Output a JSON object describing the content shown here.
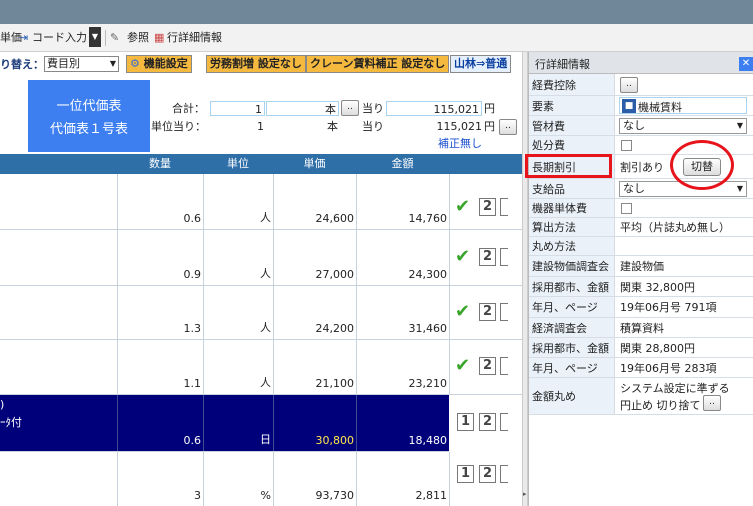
{
  "toolbar": {
    "cut_label": "単価",
    "code_input_label": "コード入力",
    "reference_label": "参照",
    "row_detail_label": "行詳細情報"
  },
  "options": {
    "switch_label": "り替え：",
    "category_select": "費目別",
    "function_settings": "機能設定",
    "labor_markup": "労務割増 設定なし",
    "crane_rent": "クレーン賃料補正 設定なし",
    "mountain_forest": "山林⇒普通"
  },
  "summary": {
    "blue_box_line1": "一位代価表",
    "blue_box_line2": "代価表１号表",
    "total_label": "合計：",
    "total_qty": "1",
    "total_unit": "本",
    "per_label": "当り",
    "total_amount": "115,021",
    "yen": "円",
    "per_unit_label": "単位当り：",
    "per_unit_qty": "1",
    "per_unit_unit": "本",
    "per_unit_per": "当り",
    "per_unit_amount": "115,021",
    "per_unit_yen": "円",
    "correction_link": "補正無し"
  },
  "table": {
    "headers": {
      "qty": "数量",
      "unit": "単位",
      "price": "単価",
      "amount": "金額"
    },
    "rows": [
      {
        "qty": "0.6",
        "unit": "人",
        "price": "24,600",
        "amount": "14,760",
        "check": "✔",
        "n1": "2"
      },
      {
        "qty": "0.9",
        "unit": "人",
        "price": "27,000",
        "amount": "24,300",
        "check": "✔",
        "n1": "2"
      },
      {
        "qty": "1.3",
        "unit": "人",
        "price": "24,200",
        "amount": "31,460",
        "check": "✔",
        "n1": "2"
      },
      {
        "qty": "1.1",
        "unit": "人",
        "price": "21,100",
        "amount": "23,210",
        "check": "✔",
        "n1": "2"
      },
      {
        "name1": ")",
        "name2": "ｰﾀ付",
        "qty": "0.6",
        "unit": "日",
        "price": "30,800",
        "amount": "18,480",
        "n0": "1",
        "n1": "2"
      },
      {
        "qty": "3",
        "unit": "%",
        "price": "93,730",
        "amount": "2,811",
        "n0": "1",
        "n1": "2"
      }
    ]
  },
  "panel": {
    "title": "行詳細情報",
    "close": "✕",
    "rows": {
      "expense_deduction": "経費控除",
      "element_label": "要素",
      "element_value": "機械賃料",
      "management_label": "管材費",
      "management_value": "なし",
      "disposal_label": "処分費",
      "long_term_label": "長期割引",
      "long_term_value": "割引あり",
      "switch_button": "切替",
      "supplied_label": "支給品",
      "supplied_value": "なし",
      "machine_unit_label": "機器単体費",
      "calc_label": "算出方法",
      "calc_value": "平均（片誌丸め無し）",
      "rounding_label": "丸め方法",
      "survey_label": "建設物価調査会",
      "survey_value": "建設物価",
      "city1_label": "採用都市、金額",
      "city1_value": "関東 32,800円",
      "page1_label": "年月、ページ",
      "page1_value": "19年06月号 791項",
      "econ_label": "経済調査会",
      "econ_value": "積算資料",
      "city2_label": "採用都市、金額",
      "city2_value": "関東 28,800円",
      "page2_label": "年月、ページ",
      "page2_value": "19年06月号 283項",
      "amount_round_label": "金額丸め",
      "amount_round_value1": "システム設定に準ずる",
      "amount_round_value2": "円止め 切り捨て"
    }
  },
  "colors": {
    "header_blue": "#2f6fa8",
    "selected_row": "#00007a",
    "accent_blue": "#3d7ff0",
    "check_green": "#3aa52b",
    "annotation_red": "#e8141c"
  }
}
